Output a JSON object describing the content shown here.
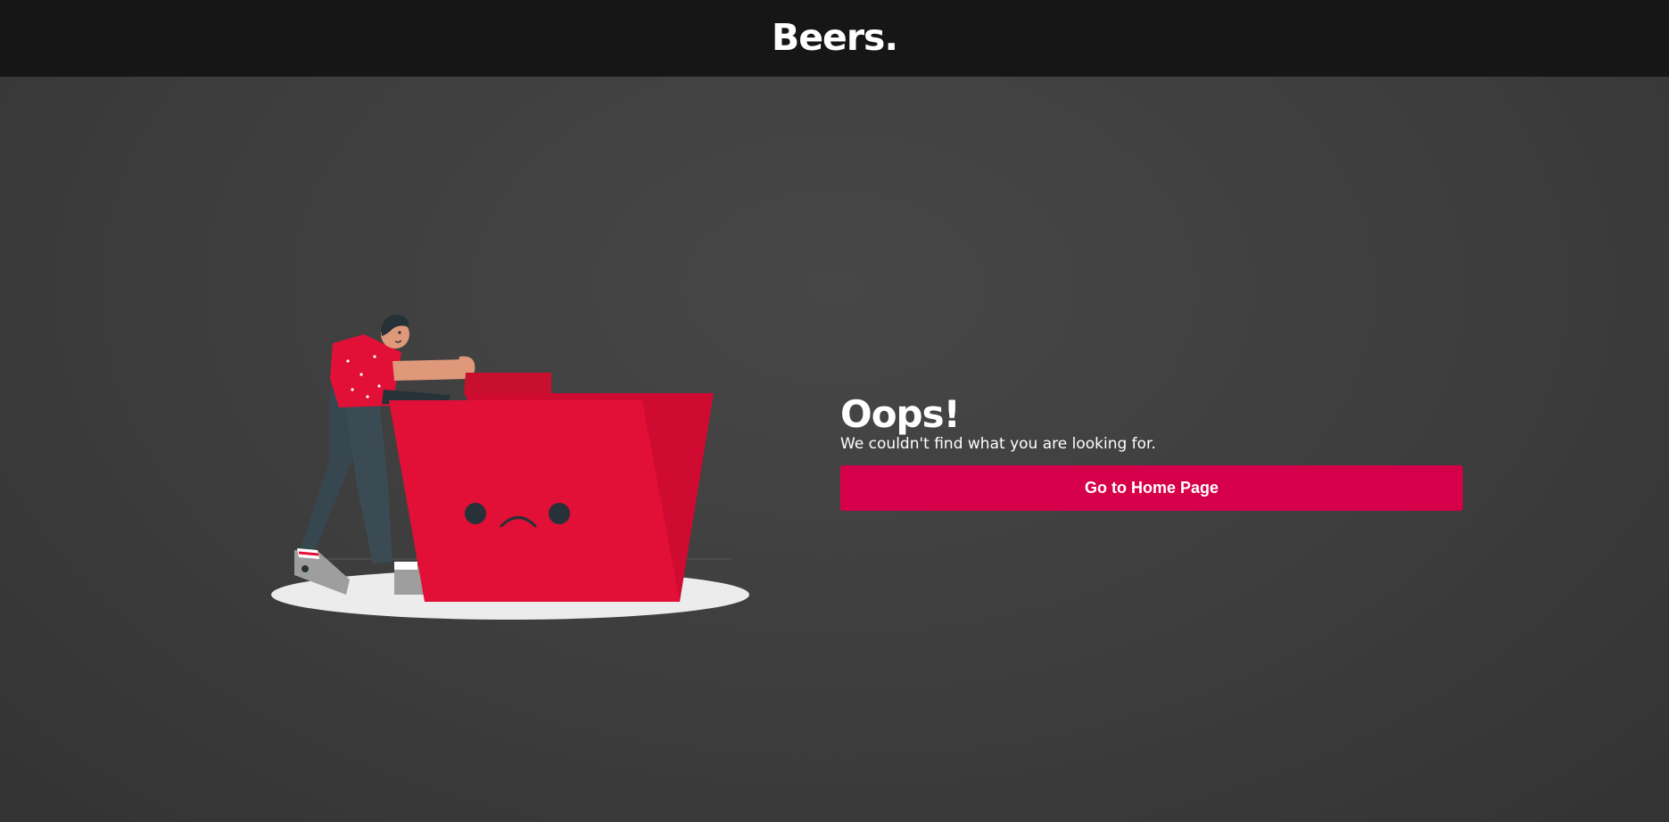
{
  "header": {
    "brand": "Beers."
  },
  "error": {
    "heading": "Oops!",
    "message": "We couldn't find what you are looking for.",
    "button_label": "Go to Home Page"
  },
  "colors": {
    "accent": "#d6004a",
    "header_bg": "#161616",
    "page_bg": "#404040",
    "folder": "#e20f36"
  },
  "illustration": {
    "icon": "sad-folder-illustration"
  }
}
